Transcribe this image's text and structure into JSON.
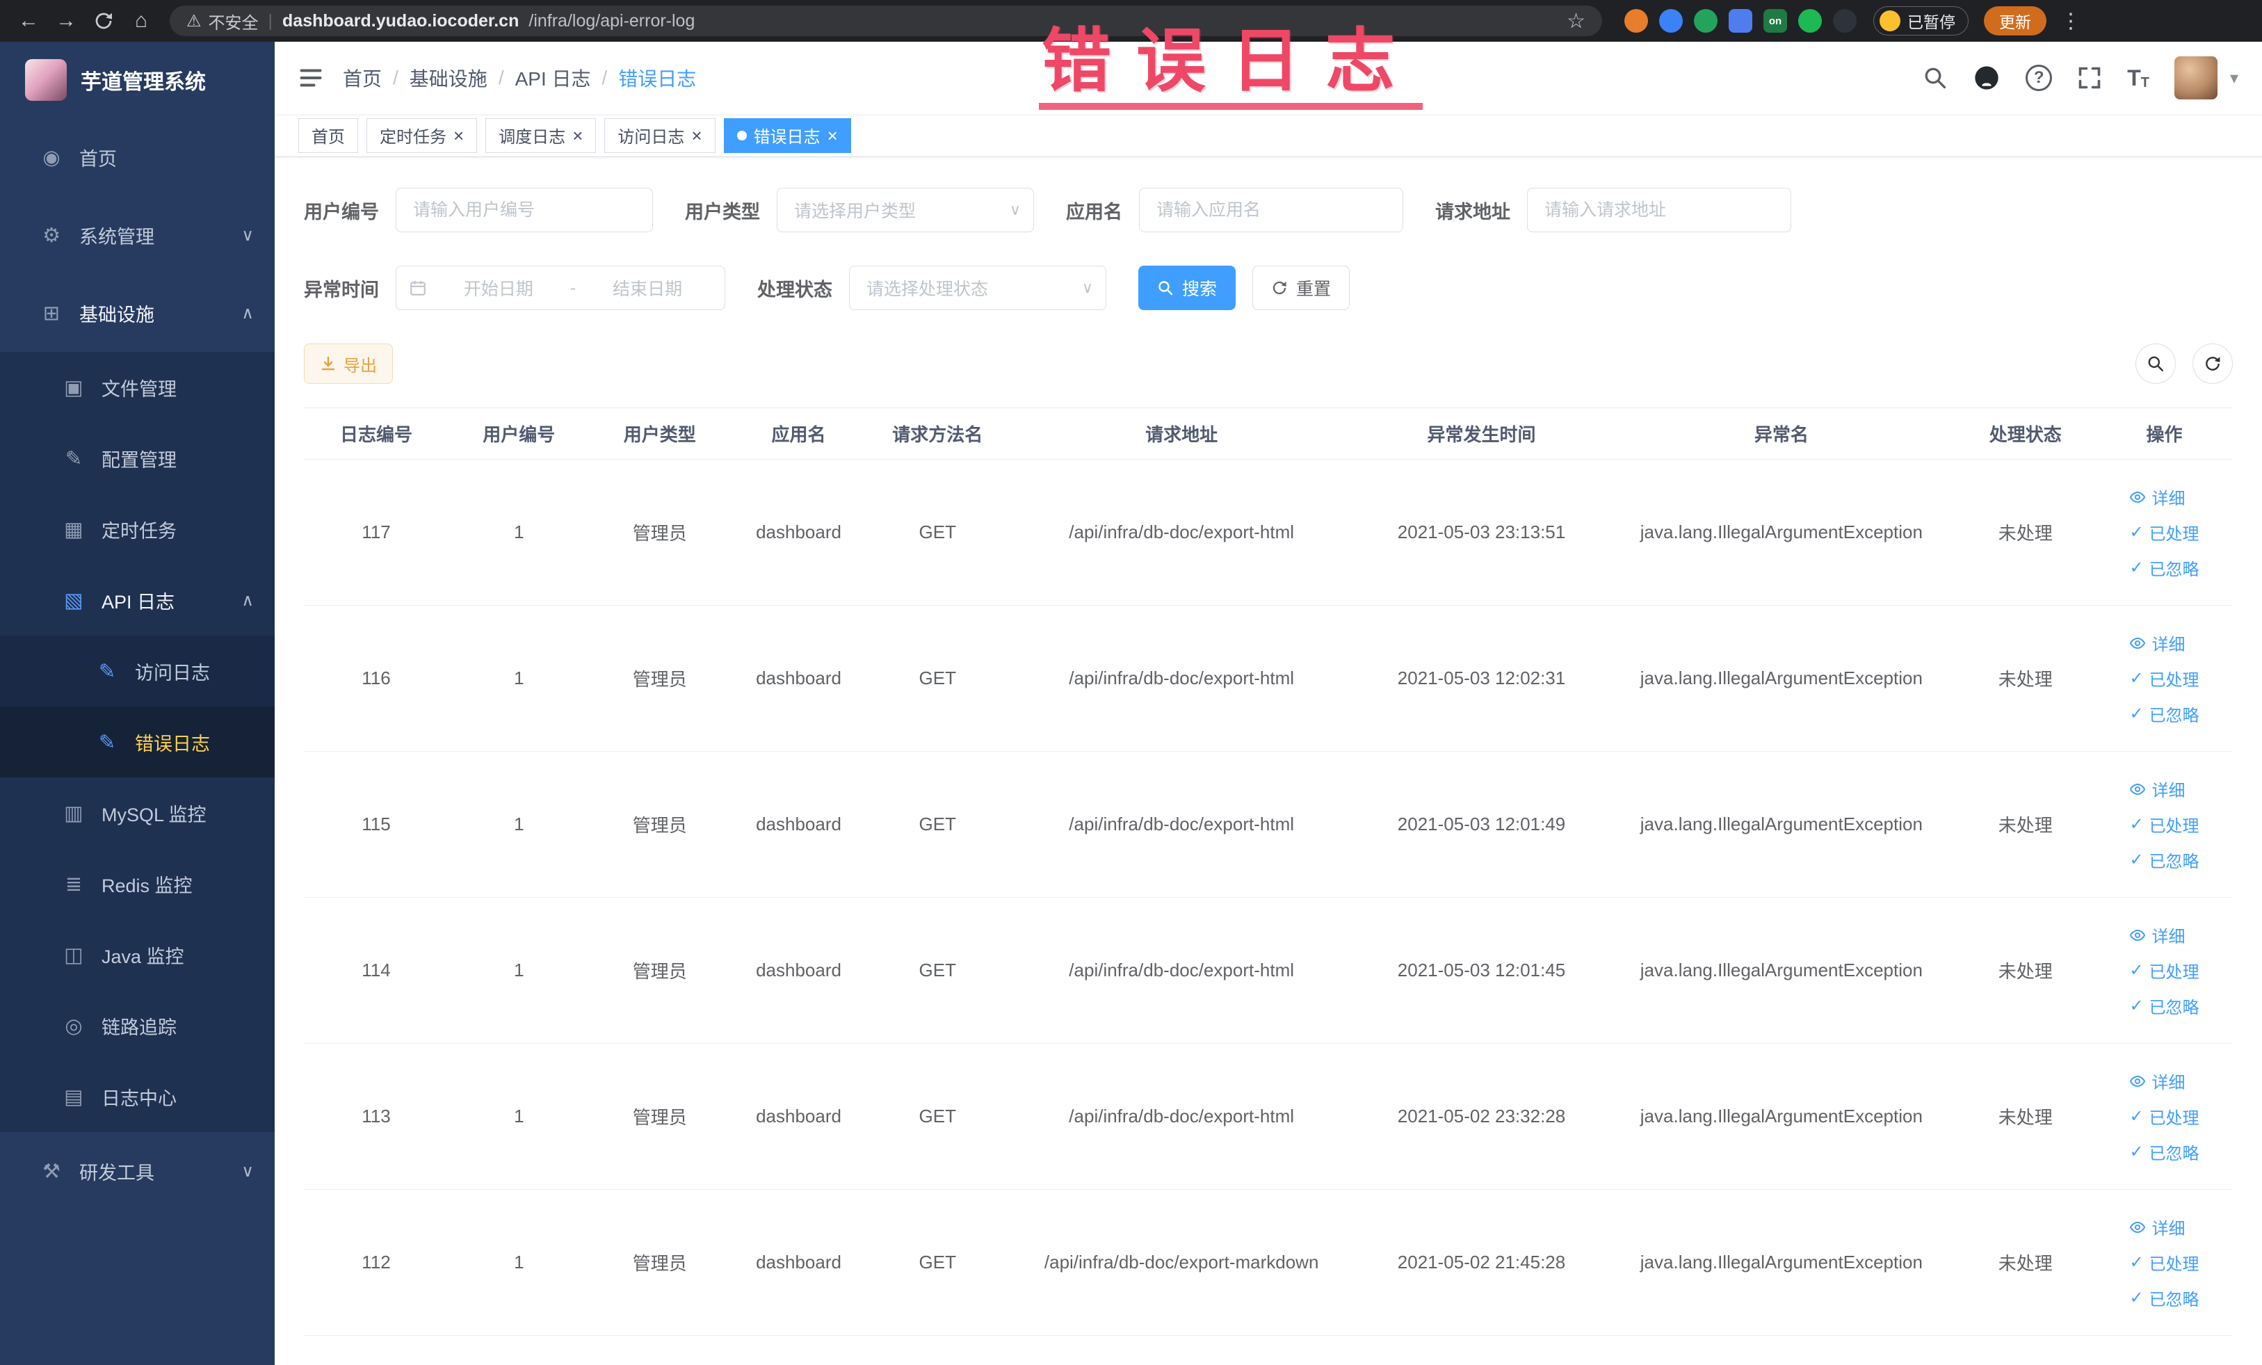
{
  "theme": {
    "primary": "#409EFF",
    "warning": "#E6A23C",
    "annotation_color": "#EE4866",
    "sidebar_bg": "#263B5F",
    "sidebar_active_text": "#FFD04B",
    "chrome_bg": "#202124"
  },
  "icons": {
    "back": "←",
    "forward": "→",
    "home": "⌂",
    "warning": "⚠",
    "star": "☆",
    "dots": "⋮",
    "pipe": "|",
    "chevron_down": "∨",
    "chevron_up": "∧",
    "close": "×",
    "check": "✓",
    "caret_down": "▾",
    "question": "?",
    "size_big": "T",
    "size_small": "T",
    "dashboard": "◉",
    "gear": "⚙",
    "infra": "⊞",
    "folder": "▣",
    "config": "✎",
    "schedule": "▦",
    "api_log": "▧",
    "doc": "✎",
    "mysql": "▥",
    "redis": "≣",
    "java": "◫",
    "trace": "◎",
    "log_center": "▤",
    "tool": "⚒"
  },
  "browser": {
    "security_label": "不安全",
    "url_domain": "dashboard.yudao.iocoder.cn",
    "url_path": "/infra/log/api-error-log",
    "ext_on_label": "on",
    "paused_label": "已暂停",
    "update_label": "更新"
  },
  "annotation": {
    "text": "错误日志"
  },
  "sidebar": {
    "logo_title": "芋道管理系统",
    "items": [
      {
        "label": "首页"
      },
      {
        "label": "系统管理"
      },
      {
        "label": "基础设施"
      },
      {
        "label": "文件管理"
      },
      {
        "label": "配置管理"
      },
      {
        "label": "定时任务"
      },
      {
        "label": "API 日志"
      },
      {
        "label": "访问日志"
      },
      {
        "label": "错误日志"
      },
      {
        "label": "MySQL 监控"
      },
      {
        "label": "Redis 监控"
      },
      {
        "label": "Java 监控"
      },
      {
        "label": "链路追踪"
      },
      {
        "label": "日志中心"
      },
      {
        "label": "研发工具"
      }
    ]
  },
  "breadcrumb": {
    "separator": "/",
    "items": [
      "首页",
      "基础设施",
      "API 日志",
      "错误日志"
    ]
  },
  "tabs": {
    "items": [
      {
        "label": "首页"
      },
      {
        "label": "定时任务"
      },
      {
        "label": "调度日志"
      },
      {
        "label": "访问日志"
      },
      {
        "label": "错误日志"
      }
    ]
  },
  "filters": {
    "user_id": {
      "label": "用户编号",
      "placeholder": "请输入用户编号",
      "value": ""
    },
    "user_type": {
      "label": "用户类型",
      "placeholder": "请选择用户类型",
      "value": ""
    },
    "app_name": {
      "label": "应用名",
      "placeholder": "请输入应用名",
      "value": ""
    },
    "request_url": {
      "label": "请求地址",
      "placeholder": "请输入请求地址",
      "value": ""
    },
    "exception_time": {
      "label": "异常时间",
      "start_placeholder": "开始日期",
      "separator": "-",
      "end_placeholder": "结束日期"
    },
    "process_status": {
      "label": "处理状态",
      "placeholder": "请选择处理状态",
      "value": ""
    },
    "search_label": "搜索",
    "reset_label": "重置"
  },
  "toolbar": {
    "export_label": "导出"
  },
  "table": {
    "columns": [
      "日志编号",
      "用户编号",
      "用户类型",
      "应用名",
      "请求方法名",
      "请求地址",
      "异常发生时间",
      "异常名",
      "处理状态",
      "操作"
    ],
    "actions": {
      "detail": "详细",
      "processed": "已处理",
      "ignored": "已忽略"
    },
    "rows": [
      {
        "id": "117",
        "user_id": "1",
        "user_type": "管理员",
        "app": "dashboard",
        "method": "GET",
        "url": "/api/infra/db-doc/export-html",
        "time": "2021-05-03 23:13:51",
        "exception": "java.lang.IllegalArgumentException",
        "status": "未处理"
      },
      {
        "id": "116",
        "user_id": "1",
        "user_type": "管理员",
        "app": "dashboard",
        "method": "GET",
        "url": "/api/infra/db-doc/export-html",
        "time": "2021-05-03 12:02:31",
        "exception": "java.lang.IllegalArgumentException",
        "status": "未处理"
      },
      {
        "id": "115",
        "user_id": "1",
        "user_type": "管理员",
        "app": "dashboard",
        "method": "GET",
        "url": "/api/infra/db-doc/export-html",
        "time": "2021-05-03 12:01:49",
        "exception": "java.lang.IllegalArgumentException",
        "status": "未处理"
      },
      {
        "id": "114",
        "user_id": "1",
        "user_type": "管理员",
        "app": "dashboard",
        "method": "GET",
        "url": "/api/infra/db-doc/export-html",
        "time": "2021-05-03 12:01:45",
        "exception": "java.lang.IllegalArgumentException",
        "status": "未处理"
      },
      {
        "id": "113",
        "user_id": "1",
        "user_type": "管理员",
        "app": "dashboard",
        "method": "GET",
        "url": "/api/infra/db-doc/export-html",
        "time": "2021-05-02 23:32:28",
        "exception": "java.lang.IllegalArgumentException",
        "status": "未处理"
      },
      {
        "id": "112",
        "user_id": "1",
        "user_type": "管理员",
        "app": "dashboard",
        "method": "GET",
        "url": "/api/infra/db-doc/export-markdown",
        "time": "2021-05-02 21:45:28",
        "exception": "java.lang.IllegalArgumentException",
        "status": "未处理"
      }
    ]
  }
}
